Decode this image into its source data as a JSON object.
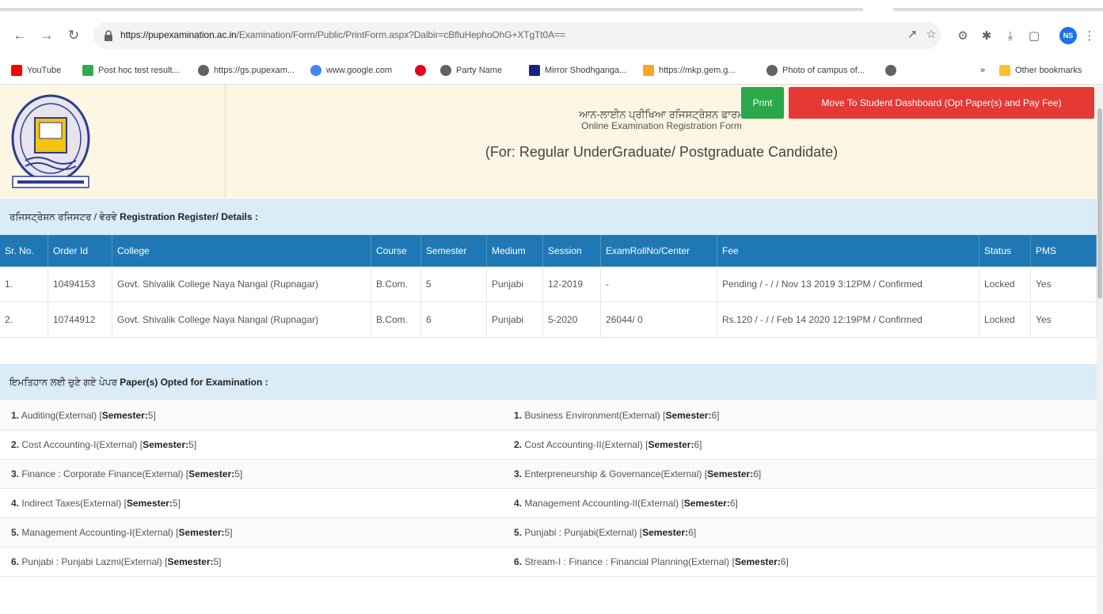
{
  "browser": {
    "url_host": "https://pupexamination.ac.in",
    "url_path": "/Examination/Form/Public/PrintForm.aspx?Dalbir=cBfluHephoOhG+XTgTt0A==",
    "avatar_initials": "NS",
    "bookmarks": [
      {
        "label": "YouTube",
        "icon": "youtube-icon",
        "color": "#ff0000"
      },
      {
        "label": "Post hoc test result...",
        "icon": "chart-icon",
        "color": "#34a853"
      },
      {
        "label": "https://gs.pupexam...",
        "icon": "globe-icon",
        "color": "#5f6368"
      },
      {
        "label": "www.google.com",
        "icon": "google-icon",
        "color": "#4285f4"
      },
      {
        "label": "",
        "icon": "pinterest-icon",
        "color": "#e60023"
      },
      {
        "label": "Party Name",
        "icon": "globe-icon",
        "color": "#5f6368"
      },
      {
        "label": "Mirror Shodhganga...",
        "icon": "shodhganga-icon",
        "color": "#1a237e"
      },
      {
        "label": "https://mkp.gem.g...",
        "icon": "gem-icon",
        "color": "#f9a825"
      },
      {
        "label": "Photo of campus of...",
        "icon": "globe-icon",
        "color": "#5f6368"
      },
      {
        "label": "",
        "icon": "globe-icon",
        "color": "#5f6368"
      }
    ],
    "more_bookmarks": "»",
    "other_bookmarks": "Other bookmarks"
  },
  "header": {
    "title_punjabi": "ਆਨ-ਲਾਈਨ ਪ੍ਰੀਖਿਆ ਰਜਿਸਟ੍ਰੇਸ਼ਨ ਫਾਰਮ",
    "title_english": "Online Examination Registration Form",
    "subtitle": "(For: Regular UnderGraduate/ Postgraduate Candidate)",
    "print_label": "Print",
    "move_label": "Move To Student Dashboard (Opt Paper(s) and Pay Fee)"
  },
  "registration": {
    "section_punjabi": "ਰਜਿਸਟ੍ਰੇਸ਼ਨ ਰਜਿਸਟਰ / ਵੇਰਵੇ",
    "section_english": "Registration Register/ Details :",
    "columns": [
      "Sr. No.",
      "Order Id",
      "College",
      "Course",
      "Semester",
      "Medium",
      "Session",
      "ExamRollNo/Center",
      "Fee",
      "Status",
      "PMS"
    ],
    "rows": [
      [
        "1.",
        "10494153",
        "Govt. Shivalik College Naya Nangal (Rupnagar)",
        "B.Com.",
        "5",
        "Punjabi",
        "12-2019",
        "-",
        "Pending / - / / Nov 13 2019 3:12PM / Confirmed",
        "Locked",
        "Yes"
      ],
      [
        "2.",
        "10744912",
        "Govt. Shivalik College Naya Nangal (Rupnagar)",
        "B.Com.",
        "6",
        "Punjabi",
        "5-2020",
        "26044/ 0",
        "Rs.120 / - / / Feb 14 2020 12:19PM / Confirmed",
        "Locked",
        "Yes"
      ]
    ]
  },
  "papers": {
    "section_punjabi": "ਇਮਤਿਹਾਨ ਲਈ ਚੁਣੇ ਗਏ ਪੇਪਰ",
    "section_english": "Paper(s) Opted for Examination :",
    "semester_label": "Semester:",
    "left": [
      {
        "num": "1.",
        "name": "Auditing(External)",
        "sem": "5"
      },
      {
        "num": "2.",
        "name": "Cost Accounting-I(External)",
        "sem": "5"
      },
      {
        "num": "3.",
        "name": "Finance : Corporate Finance(External)",
        "sem": "5"
      },
      {
        "num": "4.",
        "name": "Indirect Taxes(External)",
        "sem": "5"
      },
      {
        "num": "5.",
        "name": "Management Accounting-I(External)",
        "sem": "5"
      },
      {
        "num": "6.",
        "name": "Punjabi : Punjabi Lazmi(External)",
        "sem": "5"
      }
    ],
    "right": [
      {
        "num": "1.",
        "name": "Business Environment(External)",
        "sem": "6"
      },
      {
        "num": "2.",
        "name": "Cost Accounting-II(External)",
        "sem": "6"
      },
      {
        "num": "3.",
        "name": "Enterpreneurship & Governance(External)",
        "sem": "6"
      },
      {
        "num": "4.",
        "name": "Management Accounting-II(External)",
        "sem": "6"
      },
      {
        "num": "5.",
        "name": "Punjabi : Punjabi(External)",
        "sem": "6"
      },
      {
        "num": "6.",
        "name": "Stream-I : Finance : Financial Planning(External)",
        "sem": "6"
      }
    ]
  }
}
